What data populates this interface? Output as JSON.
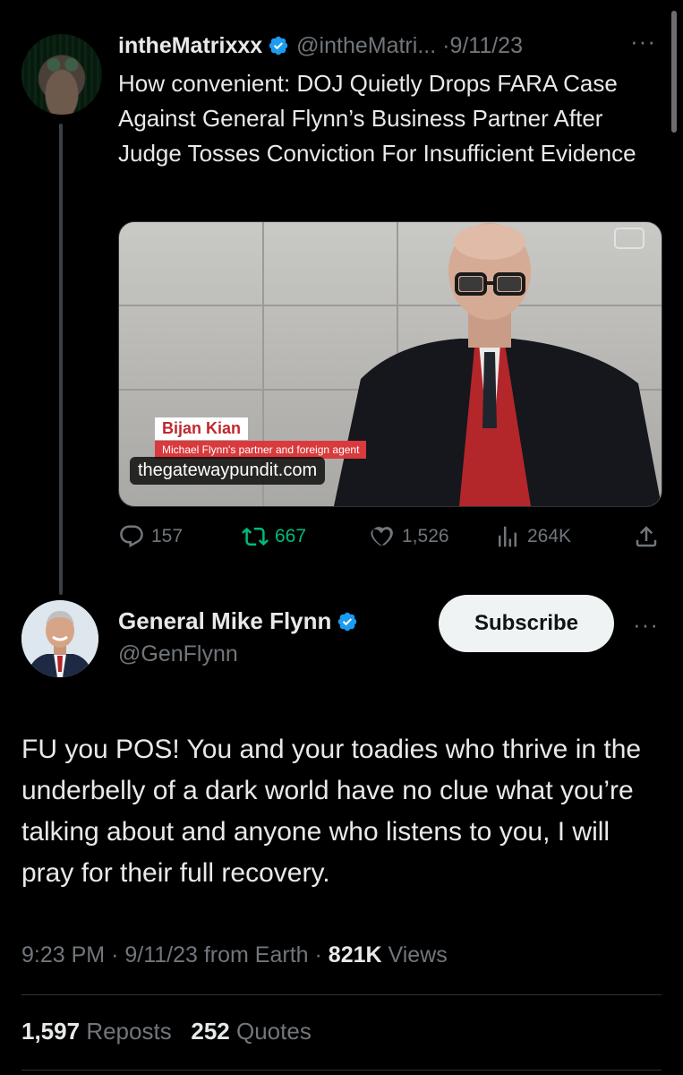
{
  "tweet1": {
    "display_name": "intheMatrixxx",
    "handle": "@intheMatri...",
    "date": "9/11/23",
    "text": "How convenient: DOJ Quietly Drops FARA Case Against General Flynn’s Business Partner After Judge Tosses Conviction For Insufficient Evidence",
    "media": {
      "lower_third_name": "Bijan Kian",
      "lower_third_subtitle": "Michael Flynn's partner and foreign agent",
      "source": "thegatewaypundit.com"
    },
    "actions": {
      "replies": "157",
      "reposts": "667",
      "likes": "1,526",
      "views": "264K"
    }
  },
  "tweet2": {
    "display_name": "General Mike Flynn",
    "handle": "@GenFlynn",
    "subscribe_label": "Subscribe",
    "text": "FU you POS! You and your toadies who thrive in the underbelly of a dark world have no clue what you’re talking about and anyone who listens to you, I will pray for their full recovery.",
    "time": "9:23 PM",
    "date": "9/11/23",
    "from": "from Earth",
    "views_count": "821K",
    "views_label": "Views",
    "reposts_count": "1,597",
    "reposts_label": "Reposts",
    "quotes_count": "252",
    "quotes_label": "Quotes"
  },
  "colors": {
    "background": "#000000",
    "text": "#e7e9ea",
    "secondary": "#71767b",
    "repost_green": "#00ba7c",
    "verified_blue": "#1d9bf0",
    "divider": "#2f3336"
  },
  "icons": [
    "verified-badge-icon",
    "more-icon",
    "reply-icon",
    "repost-icon",
    "like-icon",
    "views-icon",
    "share-icon"
  ]
}
